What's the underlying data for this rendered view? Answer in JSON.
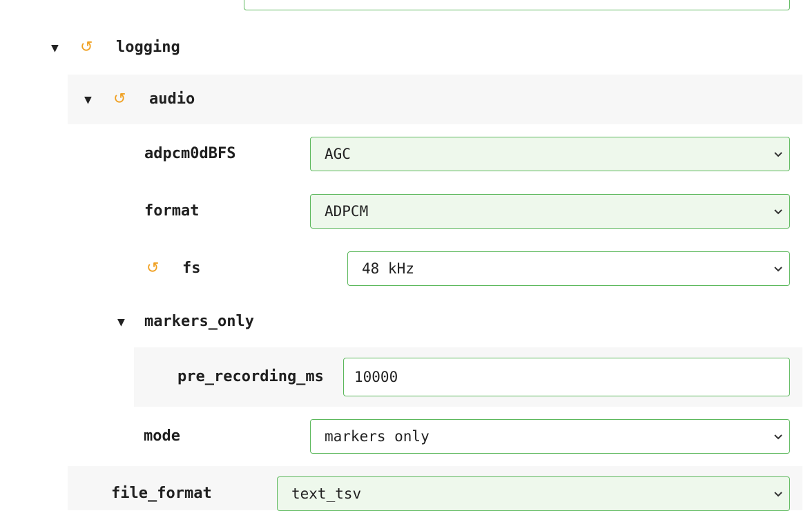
{
  "tree": {
    "logging": {
      "label": "logging",
      "arrow": "▼",
      "reset_icon": "↺",
      "audio": {
        "label": "audio",
        "arrow": "▼",
        "reset_icon": "↺",
        "adpcm0dBFS": {
          "label": "adpcm0dBFS",
          "value": "AGC"
        },
        "format": {
          "label": "format",
          "value": "ADPCM"
        },
        "fs": {
          "label": "fs",
          "value": "48 kHz",
          "reset_icon": "↺"
        },
        "markers_only": {
          "label": "markers_only",
          "arrow": "▼",
          "pre_recording_ms": {
            "label": "pre_recording_ms",
            "value": "10000"
          }
        },
        "mode": {
          "label": "mode",
          "value": "markers only"
        }
      },
      "file_format": {
        "label": "file_format",
        "value": "text_tsv"
      }
    }
  },
  "colors": {
    "accent_border": "#5cb85c",
    "modified_bg": "#eef8ec",
    "reset_icon": "#f0a020",
    "group_band": "#f7f7f7"
  }
}
